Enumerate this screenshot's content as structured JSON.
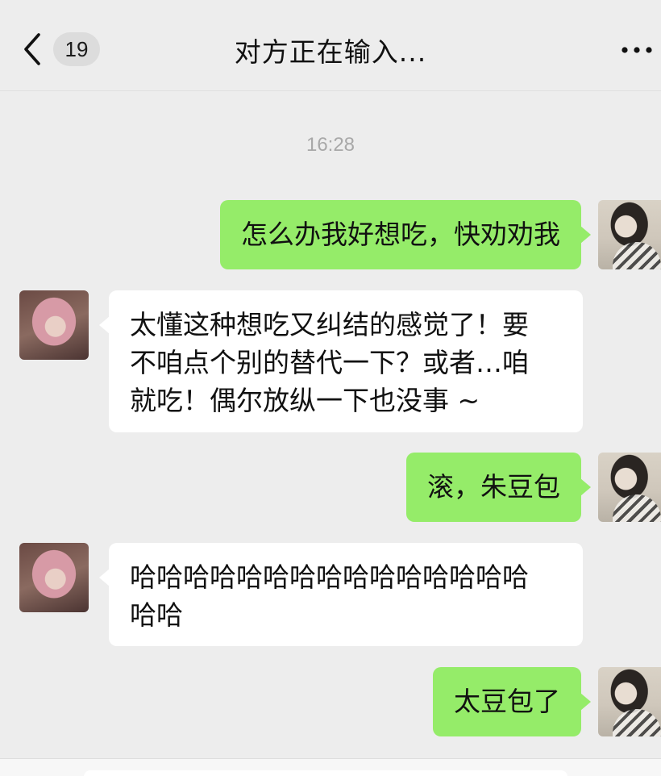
{
  "header": {
    "unread_count": "19",
    "title": "对方正在输入...",
    "back_icon": "chevron-left-icon",
    "more_icon": "ellipsis-icon"
  },
  "timestamp": "16:28",
  "messages": [
    {
      "sender": "me",
      "text": "怎么办我好想吃，快劝劝我"
    },
    {
      "sender": "other",
      "lines": [
        "太懂这种想吃又纠结的感觉了！要",
        "不咱点个别的替代一下？或者…咱",
        "就吃！偶尔放纵一下也没事 ~"
      ]
    },
    {
      "sender": "me",
      "text": "滚，朱豆包"
    },
    {
      "sender": "other",
      "lines": [
        "哈哈哈哈哈哈哈哈哈哈哈哈哈哈哈",
        "哈哈"
      ]
    },
    {
      "sender": "me",
      "text": "太豆包了"
    }
  ],
  "colors": {
    "background": "#ededed",
    "my_bubble": "#95ec69",
    "other_bubble": "#ffffff",
    "timestamp": "#a8a8a8"
  }
}
